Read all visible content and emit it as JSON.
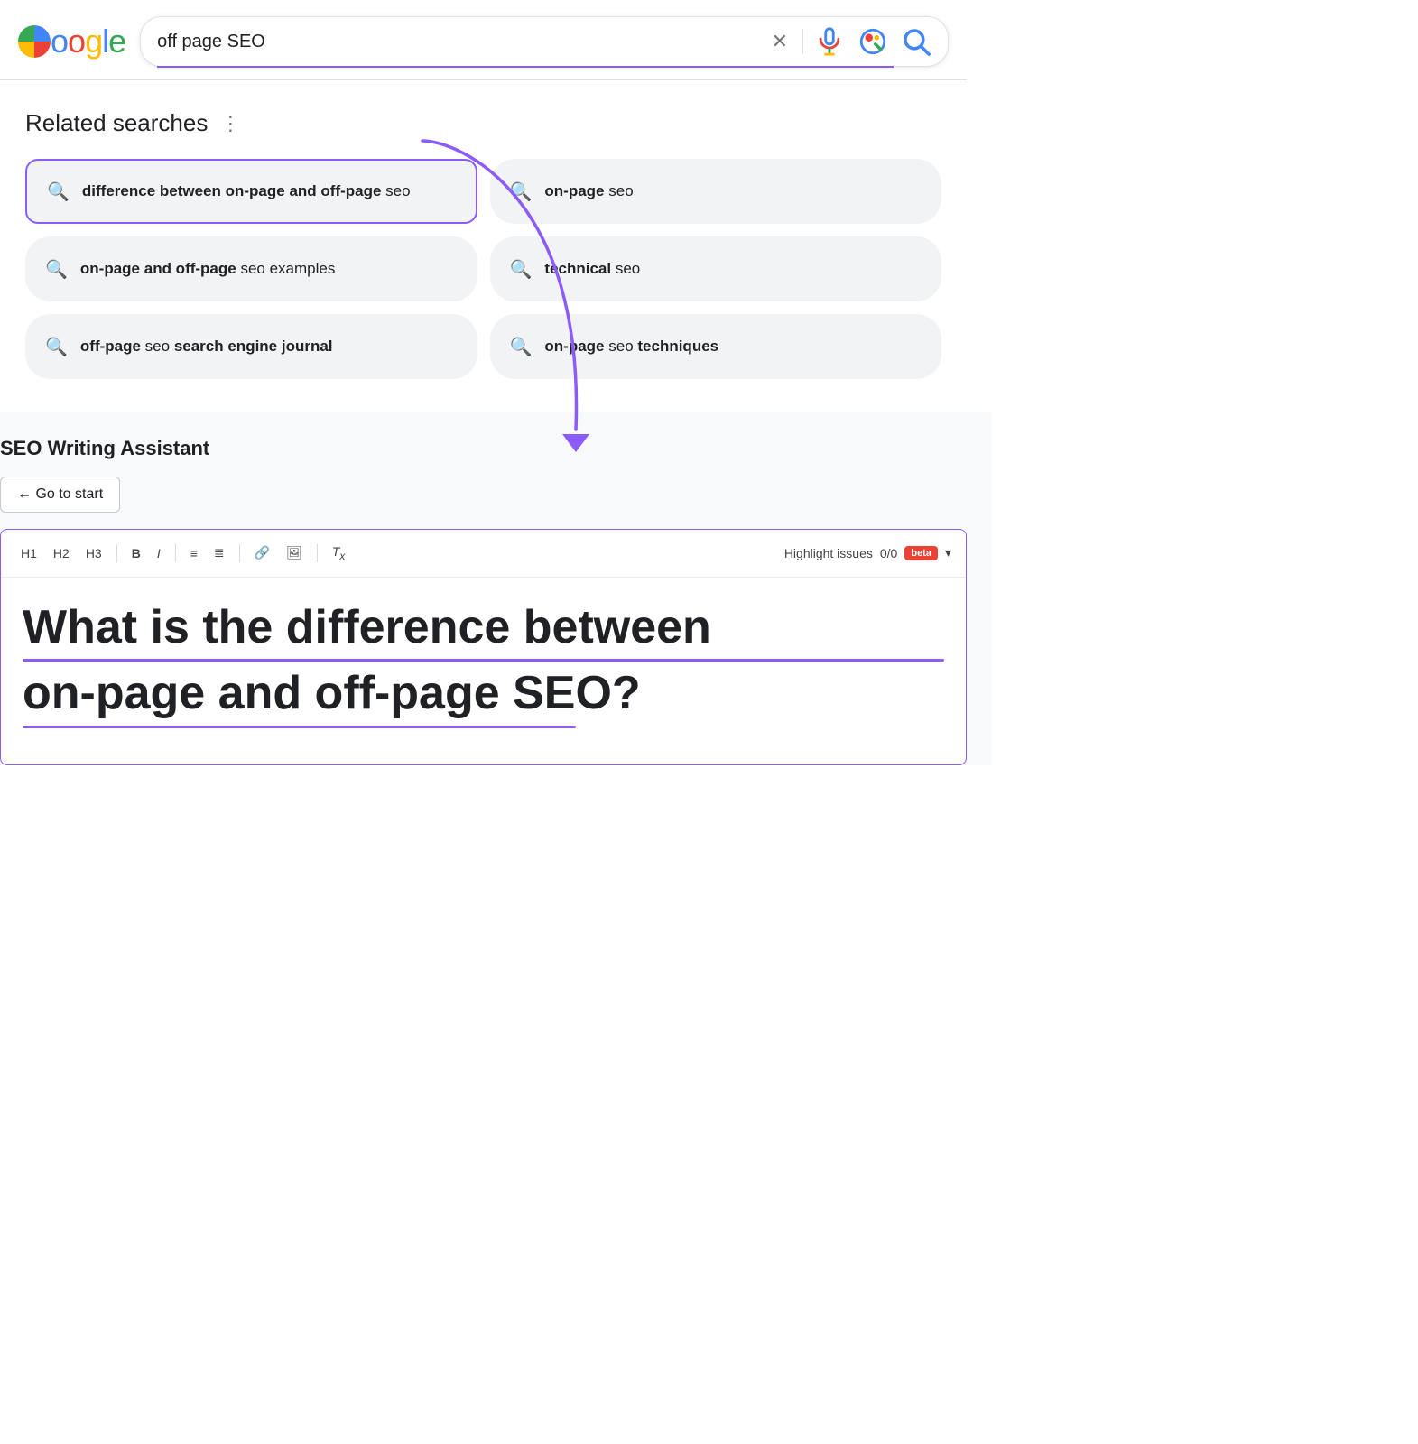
{
  "header": {
    "logo_text": "Google",
    "search_value": "off page SEO",
    "search_placeholder": "Search"
  },
  "related_searches": {
    "title": "Related searches",
    "items": [
      {
        "id": "item-1",
        "label_html": "<strong>difference between on-page and off-page</strong> seo",
        "label_plain": "difference between on-page and off-page seo",
        "highlighted": true
      },
      {
        "id": "item-2",
        "label_html": "<strong>on-page</strong> seo",
        "label_plain": "on-page seo",
        "highlighted": false
      },
      {
        "id": "item-3",
        "label_html": "<strong>on-page and off-page</strong> seo examples",
        "label_plain": "on-page and off-page seo examples",
        "highlighted": false
      },
      {
        "id": "item-4",
        "label_html": "<strong>technical</strong> seo",
        "label_plain": "technical seo",
        "highlighted": false
      },
      {
        "id": "item-5",
        "label_html": "<strong>off-page</strong> seo <strong>search engine journal</strong>",
        "label_plain": "off-page seo search engine journal",
        "highlighted": false
      },
      {
        "id": "item-6",
        "label_html": "<strong>on-page</strong> seo <strong>techniques</strong>",
        "label_plain": "on-page seo techniques",
        "highlighted": false
      }
    ]
  },
  "seo_assistant": {
    "section_title": "SEO Writing Assistant",
    "go_to_start_label": "← Go to start",
    "toolbar": {
      "h1": "H1",
      "h2": "H2",
      "h3": "H3",
      "bold": "B",
      "italic": "I",
      "ordered_list": "≡",
      "unordered_list": "≣",
      "link": "🔗",
      "image": "🖼",
      "clear_format": "Tx",
      "highlight_label": "Highlight issues",
      "count": "0/0",
      "beta_label": "beta",
      "chevron": "▾"
    },
    "heading_line1": "What is the difference between",
    "heading_line2": "on-page and off-page SEO?"
  }
}
